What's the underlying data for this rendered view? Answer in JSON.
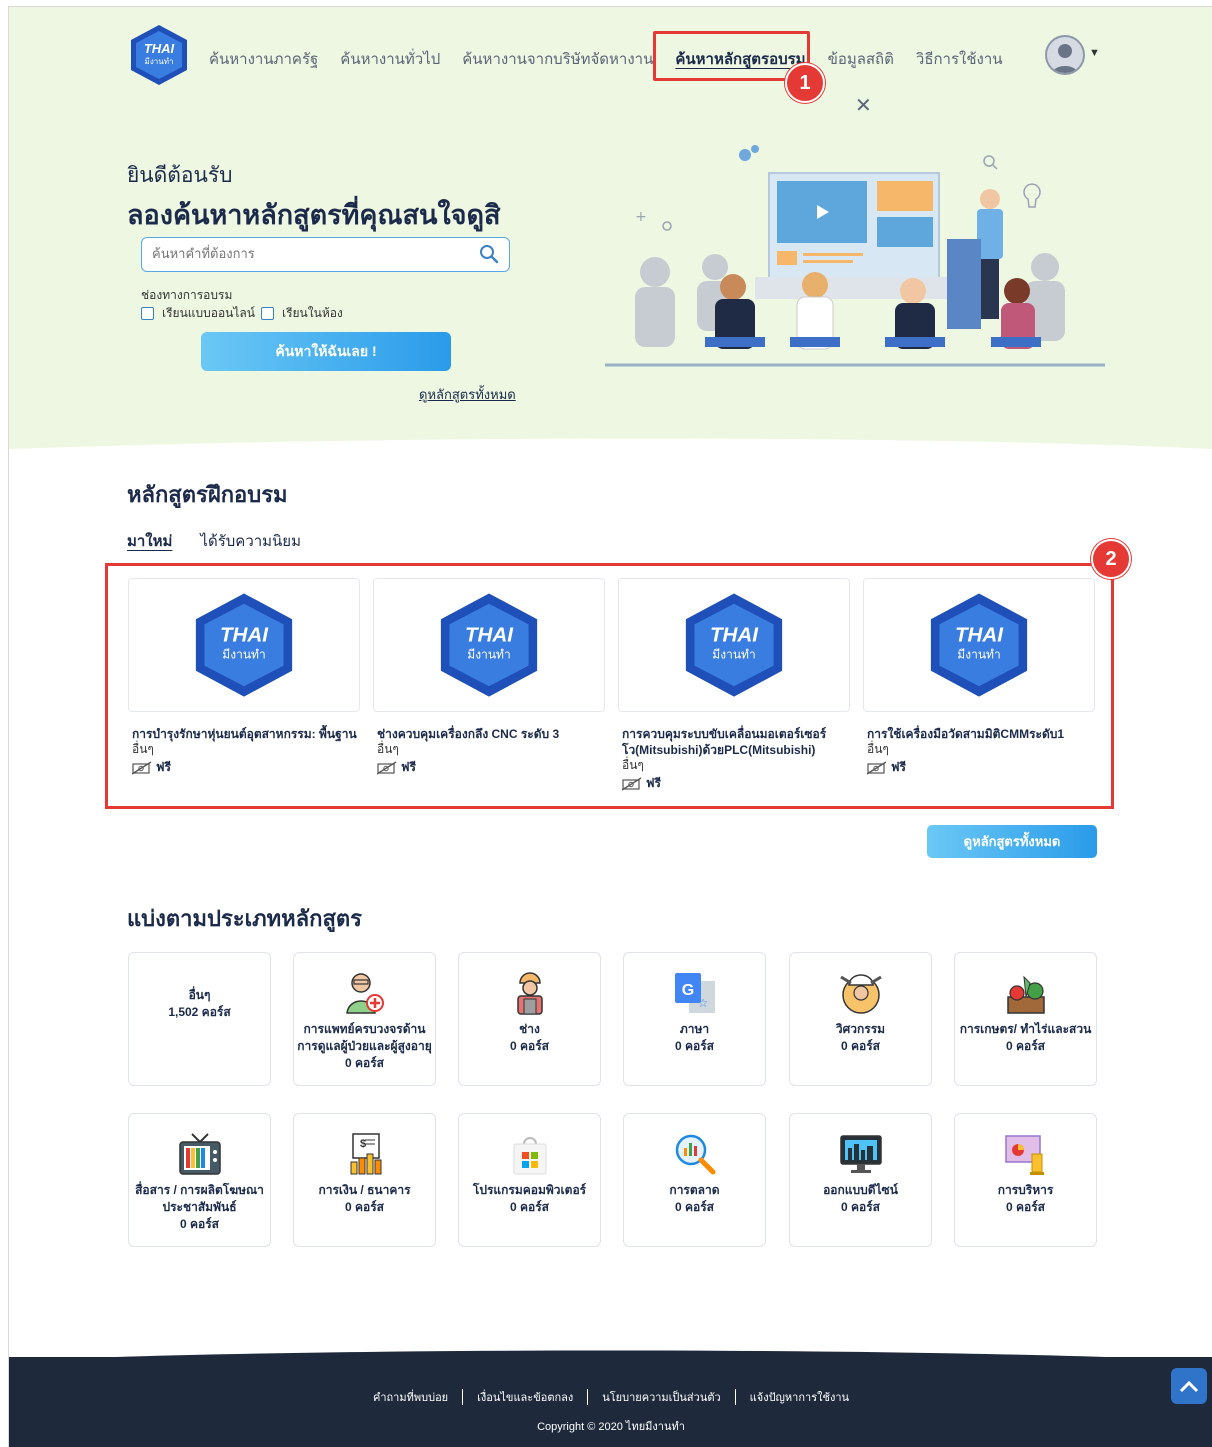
{
  "nav": {
    "links": [
      "ค้นหางานภาครัฐ",
      "ค้นหางานทั่วไป",
      "ค้นหางานจากบริษัทจัดหางาน",
      "ค้นหาหลักสูตรอบรม",
      "ข้อมูลสถิติ",
      "วิธีการใช้งาน"
    ],
    "active_index": 3,
    "logo_text": "THAI",
    "logo_sub": "มีงานทำ"
  },
  "markers": [
    "1",
    "2"
  ],
  "hero": {
    "welcome": "ยินดีต้อนรับ",
    "title": "ลองค้นหาหลักสูตรที่คุณสนใจดูสิ",
    "search_placeholder": "ค้นหาคำที่ต้องการ",
    "channel_label": "ช่องทางการอบรม",
    "option_online": "เรียนแบบออนไลน์",
    "option_class": "เรียนในห้อง",
    "search_button": "ค้นหาให้ฉันเลย !",
    "view_all_link": "ดูหลักสูตรทั้งหมด"
  },
  "courses_section": {
    "title": "หลักสูตรฝึกอบรม",
    "tabs": [
      "มาใหม่",
      "ได้รับความนิยม"
    ],
    "active_tab": 0,
    "courses": [
      {
        "name": "การบำรุงรักษาหุ่นยนต์อุตสาหกรรม: พื้นฐาน",
        "category": "อื่นๆ",
        "price": "ฟรี"
      },
      {
        "name": "ช่างควบคุมเครื่องกลึง CNC ระดับ 3",
        "category": "อื่นๆ",
        "price": "ฟรี"
      },
      {
        "name": "การควบคุมระบบขับเคลื่อนมอเตอร์เซอร์โว(Mitsubishi)ด้วยPLC(Mitsubishi)",
        "category": "อื่นๆ",
        "price": "ฟรี"
      },
      {
        "name": "การใช้เครื่องมือวัดสามมิติCMMระดับ1",
        "category": "อื่นๆ",
        "price": "ฟรี"
      }
    ],
    "view_all_button": "ดูหลักสูตรทั้งหมด"
  },
  "categories_section": {
    "title": "แบ่งตามประเภทหลักสูตร",
    "items": [
      {
        "name": "อื่นๆ",
        "count": "1,502 คอร์ส",
        "icon": "none"
      },
      {
        "name": "การแพทย์ครบวงจรด้านการดูแลผู้ป่วยและผู้สูงอายุ",
        "count": "0 คอร์ส",
        "icon": "caregiver-icon"
      },
      {
        "name": "ช่าง",
        "count": "0 คอร์ส",
        "icon": "technician-icon"
      },
      {
        "name": "ภาษา",
        "count": "0 คอร์ส",
        "icon": "translate-icon"
      },
      {
        "name": "วิศวกรรม",
        "count": "0 คอร์ส",
        "icon": "engineer-icon"
      },
      {
        "name": "การเกษตร/ ทำไร่และสวน",
        "count": "0 คอร์ส",
        "icon": "vegetables-icon"
      },
      {
        "name": "สื่อสาร / การผลิตโฆษณา ประชาสัมพันธ์",
        "count": "0 คอร์ส",
        "icon": "tv-icon"
      },
      {
        "name": "การเงิน / ธนาคาร",
        "count": "0 คอร์ส",
        "icon": "finance-icon"
      },
      {
        "name": "โปรแกรมคอมพิวเตอร์",
        "count": "0 คอร์ส",
        "icon": "store-icon"
      },
      {
        "name": "การตลาด",
        "count": "0 คอร์ส",
        "icon": "analytics-icon"
      },
      {
        "name": "ออกแบบดีไซน์",
        "count": "0 คอร์ส",
        "icon": "design-monitor-icon"
      },
      {
        "name": "การบริหาร",
        "count": "0 คอร์ส",
        "icon": "strategy-icon"
      }
    ]
  },
  "footer": {
    "links": [
      "คำถามที่พบบ่อย",
      "เงื่อนไขและข้อตกลง",
      "นโยบายความเป็นส่วนตัว",
      "แจ้งปัญหาการใช้งาน"
    ],
    "copyright": "Copyright © 2020 ไทยมีงานทำ"
  },
  "colors": {
    "hero_bg": "#eef7e1",
    "accent": "#2a9bea",
    "highlight": "#e53935",
    "footer_bg": "#1e2a3b",
    "text": "#1b2a4a"
  }
}
